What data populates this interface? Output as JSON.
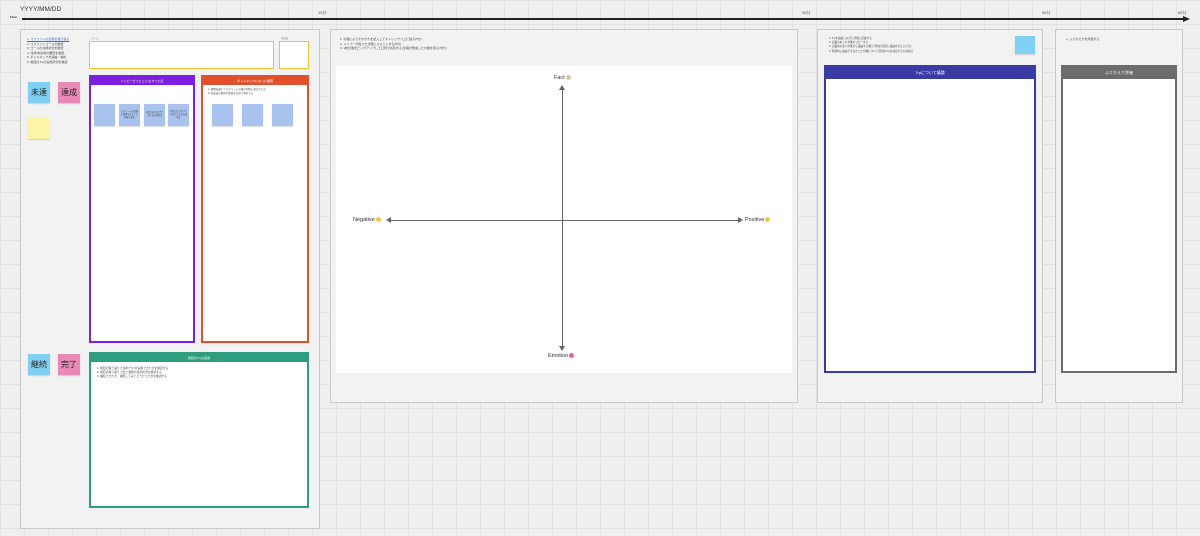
{
  "board": {
    "date": "YYYY/MM/DD",
    "timeline_label": "Flow",
    "ticks": [
      "15分",
      "35分",
      "55分",
      "60分"
    ]
  },
  "section1": {
    "instructions": [
      "1. スプリントの目標を振り返る",
      "2. スプリントゴールの確認",
      "3. ゴールの達成状況を確認",
      "4. 達成/未達成の要因を確認",
      "5. ボトルネックを議論・抽出",
      "6. 前回のTryの実施状況を確認"
    ],
    "goal_label": "ゴール",
    "rate_label": "達成度",
    "stickies": {
      "unachieved": "未達",
      "achieved": "達成",
      "continue": "継続",
      "done": "完了"
    },
    "good_column_title": "ハッピーだったこと/よかった点",
    "good_stickies": [
      "",
      "スプリントの目標に貢献できたことを振り返る",
      "予定どおり完了できたものは何か",
      "予定どおり完了できなかったものは何か"
    ],
    "bottleneck_title": "ボトルネックになった要因",
    "bottleneck_lines": [
      "1. 期間を通じてスプリント計画が実際に満たせたか",
      "2. 未達成の要因や理由を全員で共有する"
    ],
    "bottleneck_stickies": [
      "",
      "",
      ""
    ],
    "try_review_title": "前回のTryの実施",
    "try_review_lines": [
      "1. 前回の振り返りで決めたTryが実施できたかを確認する",
      "2. 前回の振り返りで出た課題の改善状況を確認する",
      "3. 継続できたか、運用してみてどうだったかを確認する"
    ]
  },
  "section2": {
    "instructions": [
      "1. 付箋によりそれぞれを記入してマトリックス上に貼る(5分)",
      "2. メンバーが貼った付箋にコメントする(5分)",
      "3. 1枚付箋をピックアップして口頭で共有する(全員が発言した付箋を見る(5分))"
    ],
    "axis": {
      "top": "Fact",
      "bottom": "Emotion",
      "left": "Negative",
      "right": "Positive"
    }
  },
  "section3": {
    "instructions": [
      "1. Tryを議論しながら付箋に記載する",
      "2. 記載のあった付箋をコピーする",
      "3. 記載者の多い付箋から議論する(終了時刻の目安に議論を打ち上げる)",
      "4. 時間内に議論できなかった付箋について次回のTryを決定するか決める"
    ],
    "note_sticky": "",
    "column_title": "Tryについて議論"
  },
  "section4": {
    "instructions": [
      "1. ふりかえりを評価する"
    ],
    "column_title": "ふりかえり評価"
  },
  "colors": {
    "purple": "#7d1fe0",
    "orange": "#e0502a",
    "green": "#2f9e7e",
    "navy": "#3a3aa3",
    "gray": "#6c6c6c",
    "yellow_border": "#f2c32f",
    "sticky_blue": "#7fd0f2",
    "sticky_pink": "#e88ab5",
    "sticky_yellow": "#fdf5a6"
  }
}
